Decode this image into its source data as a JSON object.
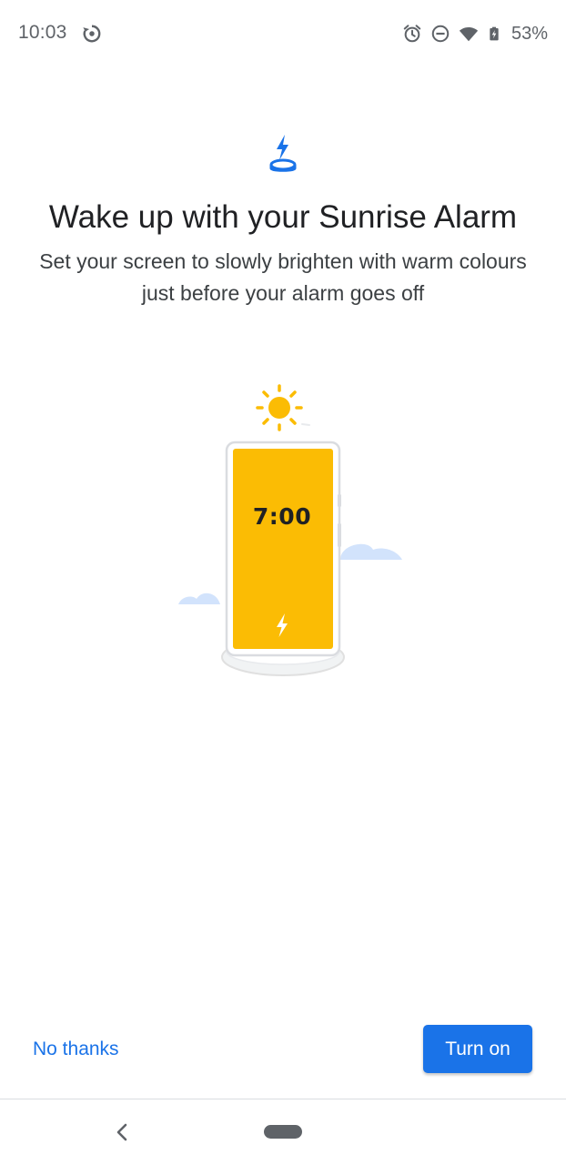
{
  "status_bar": {
    "time": "10:03",
    "battery_percent": "53%",
    "icons": [
      "sync-icon",
      "alarm-icon",
      "do-not-disturb-icon",
      "wifi-icon",
      "battery-icon"
    ]
  },
  "header": {
    "icon": "wireless-charging-icon",
    "title": "Wake up with your Sunrise Alarm",
    "subtitle": "Set your screen to slowly brighten with warm colours just before your alarm goes off"
  },
  "illustration": {
    "phone_time": "7:00",
    "icons": [
      "sun-icon",
      "cloud-icon",
      "phone-on-charger",
      "bolt-icon"
    ]
  },
  "actions": {
    "secondary_label": "No thanks",
    "primary_label": "Turn on"
  },
  "colors": {
    "accent": "#1a73e8",
    "sun": "#fbbc04",
    "cloud": "#d2e3fc",
    "phone_screen": "#fbbc04"
  },
  "nav": {
    "icons": [
      "back-icon",
      "home-pill"
    ]
  }
}
